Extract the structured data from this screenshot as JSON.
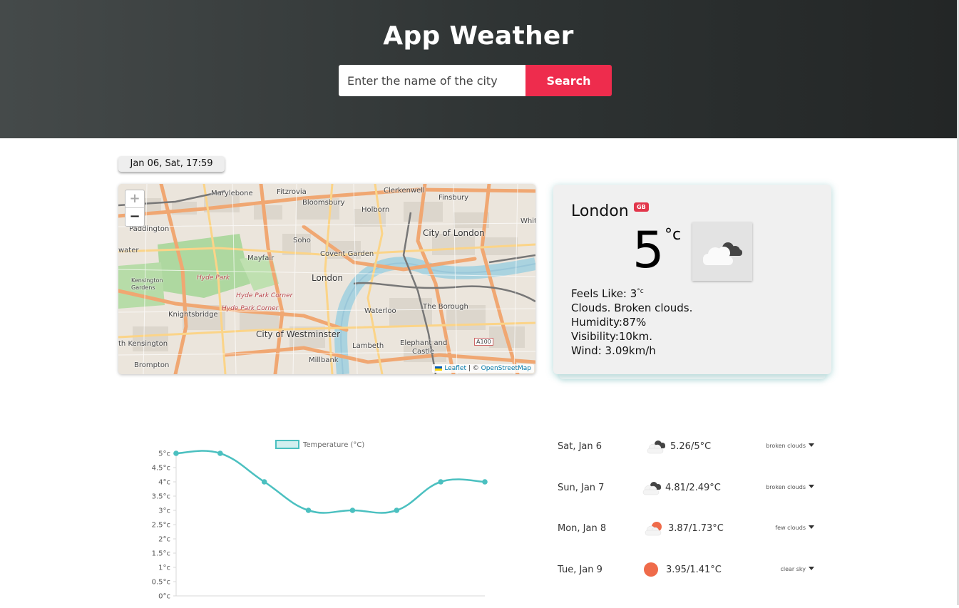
{
  "header": {
    "title": "App Weather",
    "search_placeholder": "Enter the name of the city",
    "search_label": "Search"
  },
  "date_badge": "Jan 06, Sat, 17:59",
  "map": {
    "zoom_in": "+",
    "zoom_out": "−",
    "attribution_leaflet": "Leaflet",
    "attribution_sep": " | © ",
    "attribution_osm": "OpenStreetMap",
    "labels": [
      "Marylebone",
      "Fitzrovia",
      "Clerkenwell",
      "Finsbury",
      "Bloomsbury",
      "Holborn",
      "Paddington",
      "City of London",
      "Soho",
      "Covent Garden",
      "Mayfair",
      "London",
      "Hyde Park",
      "Kensington Gardens",
      "Hyde Park Corner",
      "Waterloo",
      "The Borough",
      "Knightsbridge",
      "City of Westminster",
      "Lambeth",
      "Elephant and Castle",
      "South Kensington",
      "Brompton",
      "Millbank",
      "A100",
      "Whit",
      "water"
    ]
  },
  "current": {
    "city": "London",
    "country": "GB",
    "temp": "5",
    "unit": "°c",
    "feels_like_label": "Feels Like: 3",
    "feels_like_unit": "°c",
    "clouds": "Clouds. Broken clouds.",
    "humidity": "Humidity:87%",
    "visibility": "Visibility:10km.",
    "wind": "Wind: 3.09km/h",
    "icon": "broken-clouds-icon"
  },
  "chart_data": {
    "type": "line",
    "legend": "Temperature (°C)",
    "y_ticks": [
      "5°c",
      "4.5°c",
      "4°c",
      "3.5°c",
      "3°c",
      "2.5°c",
      "2°c",
      "1.5°c",
      "1°c",
      "0.5°c",
      "0°c"
    ],
    "ylim": [
      0,
      5
    ],
    "values": [
      5,
      5,
      4,
      3,
      3,
      3,
      4,
      4
    ],
    "color": "#4bc0c0"
  },
  "forecast": [
    {
      "day": "Sat, Jan 6",
      "temp": "5.26/5°C",
      "desc": "broken clouds",
      "icon": "broken-clouds-icon"
    },
    {
      "day": "Sun, Jan 7",
      "temp": "4.81/2.49°C",
      "desc": "broken clouds",
      "icon": "broken-clouds-icon"
    },
    {
      "day": "Mon, Jan 8",
      "temp": "3.87/1.73°C",
      "desc": "few clouds",
      "icon": "few-clouds-icon"
    },
    {
      "day": "Tue, Jan 9",
      "temp": "3.95/1.41°C",
      "desc": "clear sky",
      "icon": "sun-icon"
    }
  ],
  "colors": {
    "accent": "#ee2c4d",
    "chart_line": "#4bc0c0",
    "sun": "#ef6b4a"
  }
}
